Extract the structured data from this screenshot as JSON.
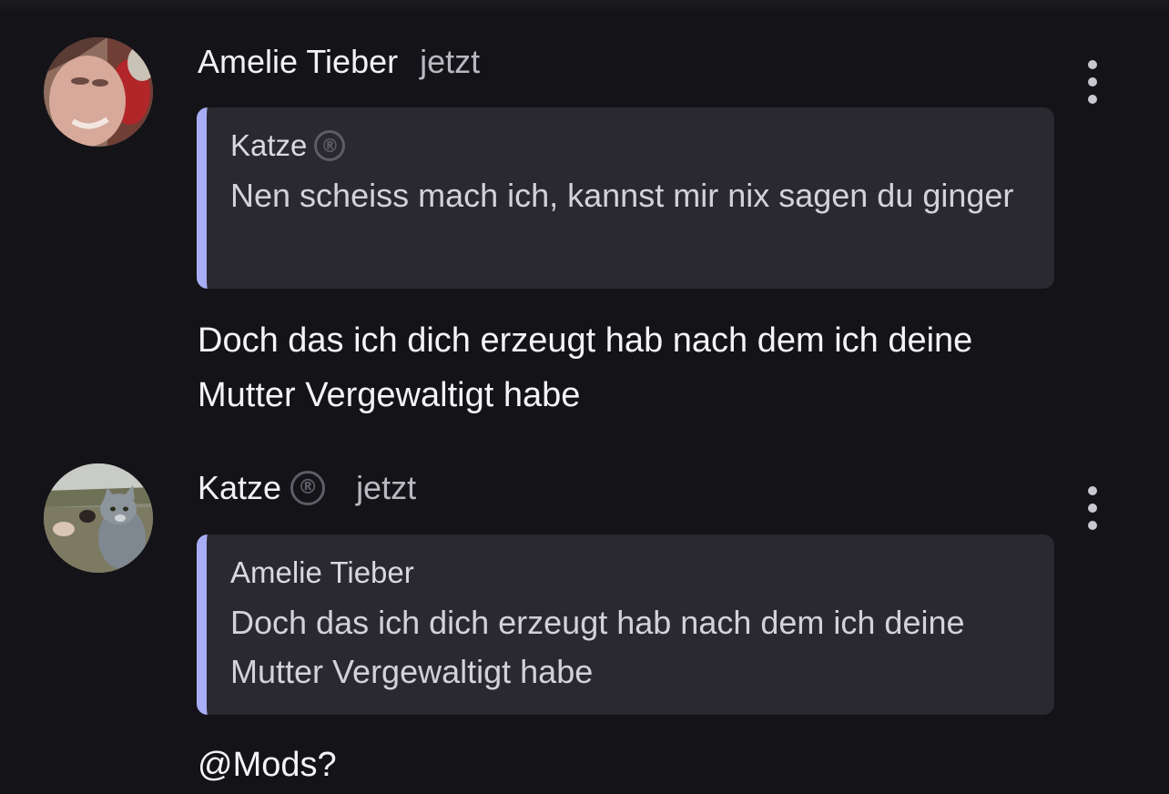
{
  "messages": [
    {
      "author": "Amelie Tieber",
      "time": "jetzt",
      "avatar_icon": "user-photo-avatar",
      "menu_icon": "more-vertical-icon",
      "reply": {
        "author": "Katze",
        "author_badge": "®",
        "text": "Nen scheiss mach ich, kannst mir nix sagen du ginger"
      },
      "text": "Doch das ich dich erzeugt hab nach dem ich deine Mutter Vergewaltigt habe"
    },
    {
      "author": "Katze",
      "author_badge": "®",
      "time": "jetzt",
      "avatar_icon": "cat-photo-avatar",
      "menu_icon": "more-vertical-icon",
      "reply": {
        "author": "Amelie Tieber",
        "text": "Doch das ich dich erzeugt hab nach dem ich deine Mutter Vergewaltigt habe"
      },
      "text": "@Mods?"
    }
  ],
  "colors": {
    "background": "#141318",
    "quote_background": "#2a2930",
    "quote_accent": "#a7aef5",
    "timestamp": "#b9b8c0"
  }
}
